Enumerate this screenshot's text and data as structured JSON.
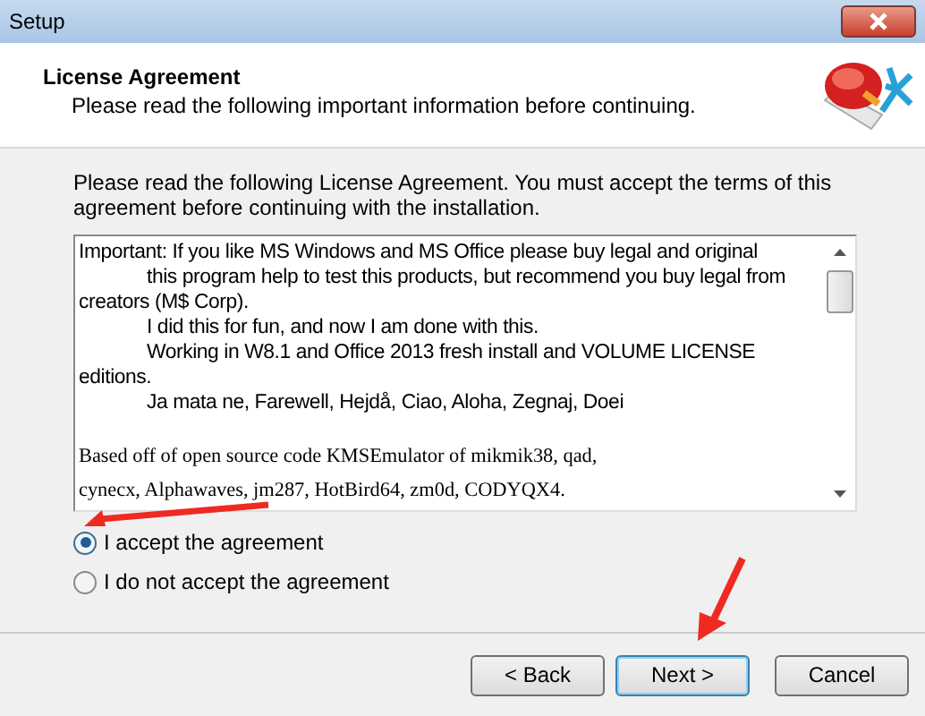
{
  "window": {
    "title": "Setup"
  },
  "header": {
    "title": "License Agreement",
    "subtitle": "Please read the following important information before continuing."
  },
  "intro": "Please read the following License Agreement. You must accept the terms of this agreement before continuing with the installation.",
  "license_lines": [
    {
      "kind": "prose",
      "indent": false,
      "text": "Important: If you like MS Windows and MS Office please buy legal and original"
    },
    {
      "kind": "prose",
      "indent": true,
      "text": "this program help to test this products, but recommend you buy legal from"
    },
    {
      "kind": "prose",
      "indent": false,
      "text": "creators (M$ Corp)."
    },
    {
      "kind": "prose",
      "indent": true,
      "text": "I did this for fun, and now I am done with this."
    },
    {
      "kind": "prose",
      "indent": true,
      "text": "Working in W8.1 and Office 2013 fresh install and VOLUME LICENSE"
    },
    {
      "kind": "prose",
      "indent": false,
      "text": "editions."
    },
    {
      "kind": "prose",
      "indent": true,
      "text": "Ja mata ne, Farewell, Hejdå, Ciao, Aloha, Zegnaj, Doei"
    },
    {
      "kind": "gap"
    },
    {
      "kind": "mono",
      "indent": false,
      "text": "Based off of open source code KMSEmulator of mikmik38, qad,"
    },
    {
      "kind": "mono",
      "indent": false,
      "text": "cynecx, Alphawaves, jm287, HotBird64, zm0d, CODYQX4."
    }
  ],
  "options": [
    {
      "label": "I accept the agreement",
      "selected": true
    },
    {
      "label": "I do not accept the agreement",
      "selected": false
    }
  ],
  "buttons": [
    {
      "label": "< Back",
      "focused": false
    },
    {
      "label": "Next >",
      "focused": true
    },
    {
      "label": "Cancel",
      "focused": false
    }
  ]
}
